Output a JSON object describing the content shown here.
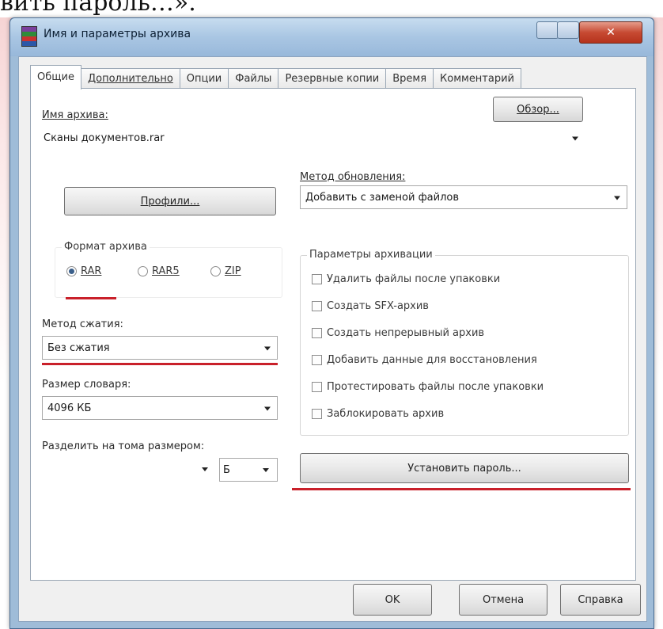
{
  "page_text": "вить пароль…».",
  "window": {
    "title": "Имя и параметры архива",
    "close_glyph": "✕"
  },
  "tabs": [
    {
      "label": "Общие"
    },
    {
      "label": "Дополнительно"
    },
    {
      "label": "Опции"
    },
    {
      "label": "Файлы"
    },
    {
      "label": "Резервные копии"
    },
    {
      "label": "Время"
    },
    {
      "label": "Комментарий"
    }
  ],
  "archive_name": {
    "label": "Имя архива:",
    "value": "Сканы документов.rar",
    "browse_label": "Обзор..."
  },
  "update_method": {
    "label": "Метод обновления:",
    "value": "Добавить с заменой файлов"
  },
  "profiles_button": "Профили...",
  "archive_format": {
    "title": "Формат архива",
    "options": [
      {
        "label": "RAR",
        "checked": true
      },
      {
        "label": "RAR5",
        "checked": false
      },
      {
        "label": "ZIP",
        "checked": false
      }
    ]
  },
  "archive_params": {
    "title": "Параметры архивации",
    "items": [
      "Удалить файлы после упаковки",
      "Создать SFX-архив",
      "Создать непрерывный архив",
      "Добавить данные для восстановления",
      "Протестировать файлы после упаковки",
      "Заблокировать архив"
    ]
  },
  "compression_method": {
    "label": "Метод сжатия:",
    "value": "Без сжатия"
  },
  "dict_size": {
    "label": "Размер словаря:",
    "value": "4096 КБ"
  },
  "split": {
    "label": "Разделить на тома размером:",
    "unit": "Б"
  },
  "set_password_button": "Установить пароль...",
  "footer": {
    "ok": "OK",
    "cancel": "Отмена",
    "help": "Справка"
  },
  "colors": {
    "highlight_underline": "#c9202a",
    "title_bar": "#a9c6e3"
  }
}
